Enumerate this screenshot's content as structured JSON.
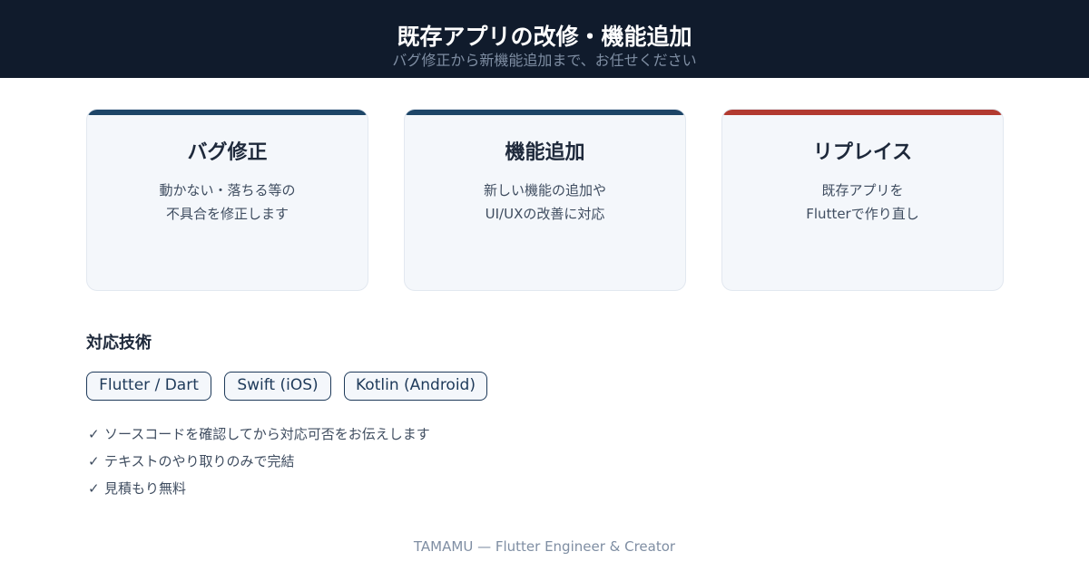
{
  "header": {
    "title": "既存アプリの改修・機能追加",
    "subtitle": "バグ修正から新機能追加まで、お任せください"
  },
  "cards": [
    {
      "title": "バグ修正",
      "desc_line1": "動かない・落ちる等の",
      "desc_line2": "不具合を修正します",
      "accent": "#1d4567"
    },
    {
      "title": "機能追加",
      "desc_line1": "新しい機能の追加や",
      "desc_line2": "UI/UXの改善に対応",
      "accent": "#1d4567"
    },
    {
      "title": "リプレイス",
      "desc_line1": "既存アプリを",
      "desc_line2": "Flutterで作り直し",
      "accent": "#b23a30"
    }
  ],
  "tech": {
    "heading": "対応技術",
    "items": [
      "Flutter / Dart",
      "Swift (iOS)",
      "Kotlin (Android)"
    ]
  },
  "checklist": {
    "mark": "✓",
    "items": [
      "ソースコードを確認してから対応可否をお伝えします",
      "テキストのやり取りのみで完結",
      "見積もり無料"
    ]
  },
  "footer": {
    "text": "TAMAMU — Flutter Engineer & Creator"
  },
  "colors": {
    "header_bg": "#101b2c",
    "card_bg": "#f4f7fb",
    "pill_border": "#1e3a5a"
  }
}
